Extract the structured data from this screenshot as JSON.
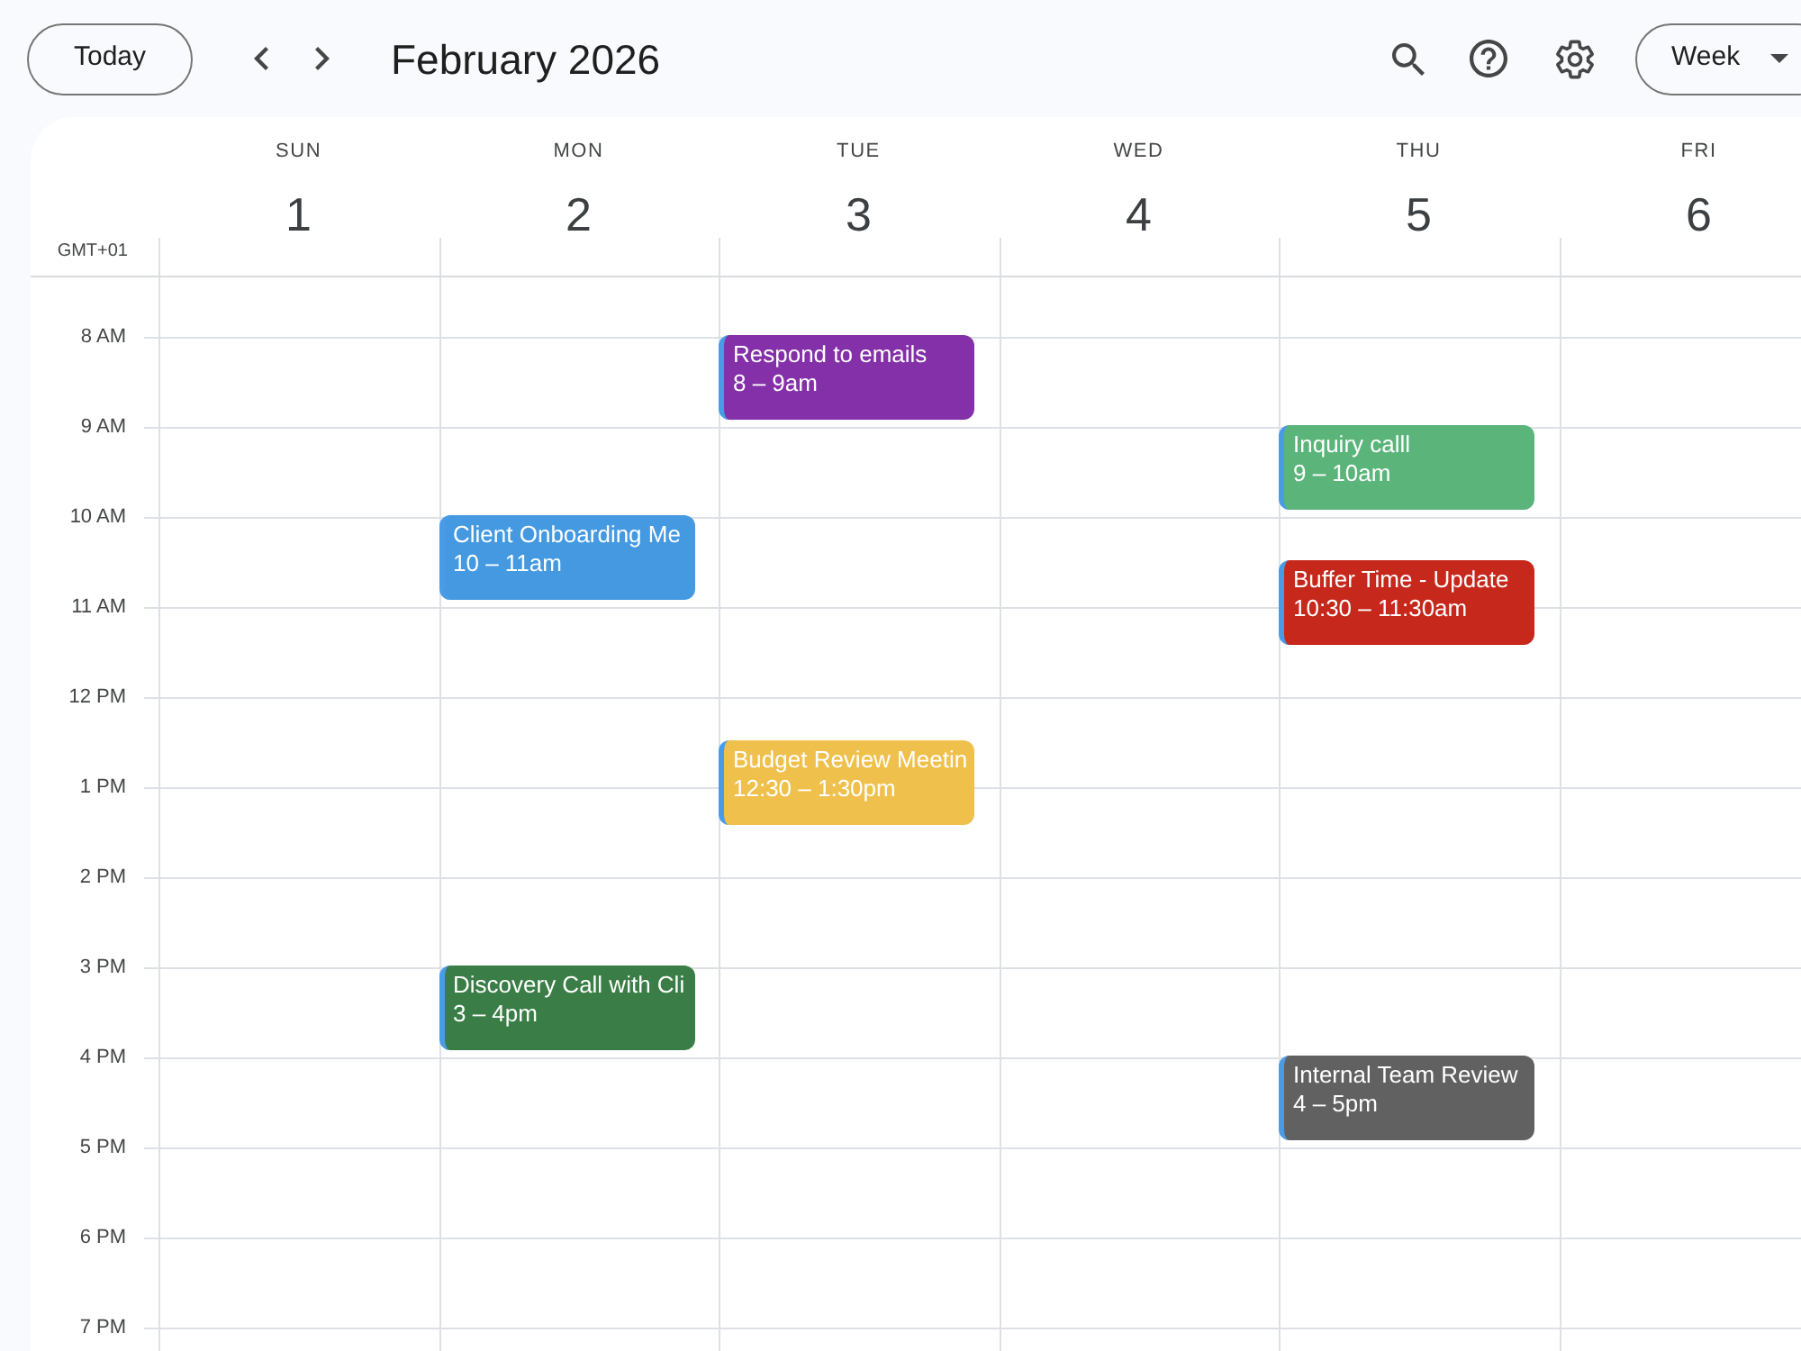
{
  "toolbar": {
    "today_button": "Today",
    "title": "February 2026",
    "view_button": "Week"
  },
  "timezone": "GMT+01",
  "hours": [
    "8 AM",
    "9 AM",
    "10 AM",
    "11 AM",
    "12 PM",
    "1 PM",
    "2 PM",
    "3 PM",
    "4 PM",
    "5 PM",
    "6 PM",
    "7 PM"
  ],
  "days": [
    {
      "weekday": "SUN",
      "date": "1"
    },
    {
      "weekday": "MON",
      "date": "2",
      "events": [
        {
          "title": "Client Onboarding Me",
          "time": "10 – 11am",
          "color": "#4499e1"
        },
        {
          "title": "Discovery Call with Cli",
          "time": "3 – 4pm",
          "color": "#3a7d46"
        }
      ]
    },
    {
      "weekday": "TUE",
      "date": "3",
      "events": [
        {
          "title": "Respond to emails",
          "time": "8 – 9am",
          "color": "#8430a8"
        },
        {
          "title": "Budget Review Meetin",
          "time": "12:30 – 1:30pm",
          "color": "#f0c04d"
        }
      ]
    },
    {
      "weekday": "WED",
      "date": "4"
    },
    {
      "weekday": "THU",
      "date": "5",
      "events": [
        {
          "title": "Inquiry calll",
          "time": "9 – 10am",
          "color": "#5bb57b"
        },
        {
          "title": "Buffer Time - Update",
          "time": "10:30 – 11:30am",
          "color": "#c6281c"
        },
        {
          "title": "Internal Team Review",
          "time": "4 – 5pm",
          "color": "#616161"
        }
      ]
    },
    {
      "weekday": "FRI",
      "date": "6"
    }
  ]
}
